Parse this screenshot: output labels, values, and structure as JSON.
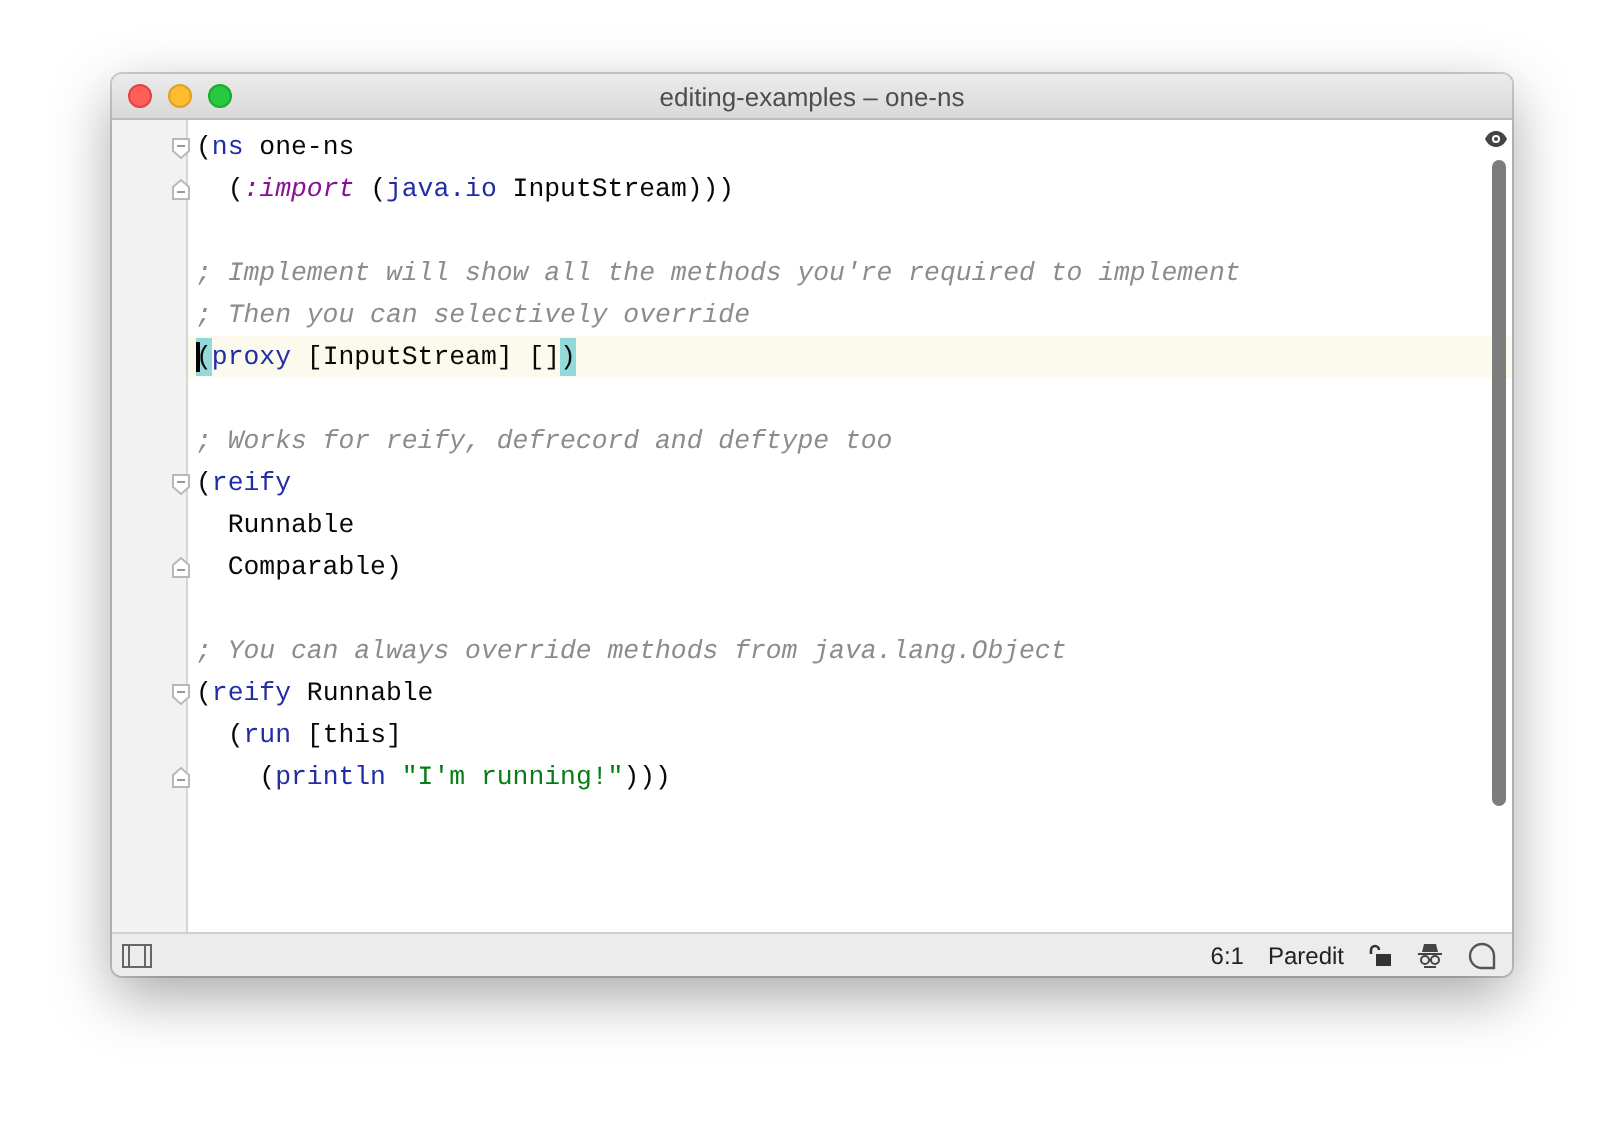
{
  "window": {
    "title": "editing-examples – one-ns"
  },
  "editor": {
    "blocks": [
      {
        "lines": [
          {
            "fold_start": true,
            "fold_end": false,
            "current": false,
            "tokens": [
              {
                "kind": "plain",
                "text": "("
              },
              {
                "kind": "keyword",
                "text": "ns"
              },
              {
                "kind": "plain",
                "text": " one-ns"
              }
            ]
          },
          {
            "fold_start": false,
            "fold_end": true,
            "current": false,
            "tokens": [
              {
                "kind": "plain",
                "text": "  ("
              },
              {
                "kind": "symbol",
                "text": ":import"
              },
              {
                "kind": "plain",
                "text": " ("
              },
              {
                "kind": "keyword",
                "text": "java.io"
              },
              {
                "kind": "plain",
                "text": " InputStream)))"
              }
            ]
          }
        ]
      },
      {
        "lines": [
          {
            "fold_start": false,
            "fold_end": false,
            "current": false,
            "tokens": [
              {
                "kind": "comment",
                "text": "; Implement will show all the methods you're required to implement"
              }
            ]
          },
          {
            "fold_start": false,
            "fold_end": false,
            "current": false,
            "tokens": [
              {
                "kind": "comment",
                "text": "; Then you can selectively override"
              }
            ]
          },
          {
            "fold_start": false,
            "fold_end": false,
            "current": true,
            "tokens": [
              {
                "kind": "match",
                "text": "("
              },
              {
                "kind": "keyword",
                "text": "proxy"
              },
              {
                "kind": "plain",
                "text": " [InputStream] []"
              },
              {
                "kind": "match",
                "text": ")"
              }
            ]
          }
        ]
      },
      {
        "lines": [
          {
            "fold_start": false,
            "fold_end": false,
            "current": false,
            "tokens": [
              {
                "kind": "comment",
                "text": "; Works for reify, defrecord and deftype too"
              }
            ]
          },
          {
            "fold_start": true,
            "fold_end": false,
            "current": false,
            "tokens": [
              {
                "kind": "plain",
                "text": "("
              },
              {
                "kind": "keyword",
                "text": "reify"
              }
            ]
          },
          {
            "fold_start": false,
            "fold_end": false,
            "current": false,
            "tokens": [
              {
                "kind": "plain",
                "text": "  Runnable"
              }
            ]
          },
          {
            "fold_start": false,
            "fold_end": true,
            "current": false,
            "tokens": [
              {
                "kind": "plain",
                "text": "  Comparable)"
              }
            ]
          }
        ]
      },
      {
        "lines": [
          {
            "fold_start": false,
            "fold_end": false,
            "current": false,
            "tokens": [
              {
                "kind": "comment",
                "text": "; You can always override methods from java.lang.Object"
              }
            ]
          },
          {
            "fold_start": true,
            "fold_end": false,
            "current": false,
            "tokens": [
              {
                "kind": "plain",
                "text": "("
              },
              {
                "kind": "keyword",
                "text": "reify"
              },
              {
                "kind": "plain",
                "text": " Runnable"
              }
            ]
          },
          {
            "fold_start": false,
            "fold_end": false,
            "current": false,
            "tokens": [
              {
                "kind": "plain",
                "text": "  ("
              },
              {
                "kind": "keyword",
                "text": "run"
              },
              {
                "kind": "plain",
                "text": " [this]"
              }
            ]
          },
          {
            "fold_start": false,
            "fold_end": true,
            "current": false,
            "tokens": [
              {
                "kind": "plain",
                "text": "    ("
              },
              {
                "kind": "keyword",
                "text": "println"
              },
              {
                "kind": "string",
                "text": " \"I'm running!\""
              },
              {
                "kind": "plain",
                "text": ")))"
              }
            ]
          }
        ]
      }
    ]
  },
  "status_bar": {
    "position": "6:1",
    "mode": "Paredit"
  }
}
